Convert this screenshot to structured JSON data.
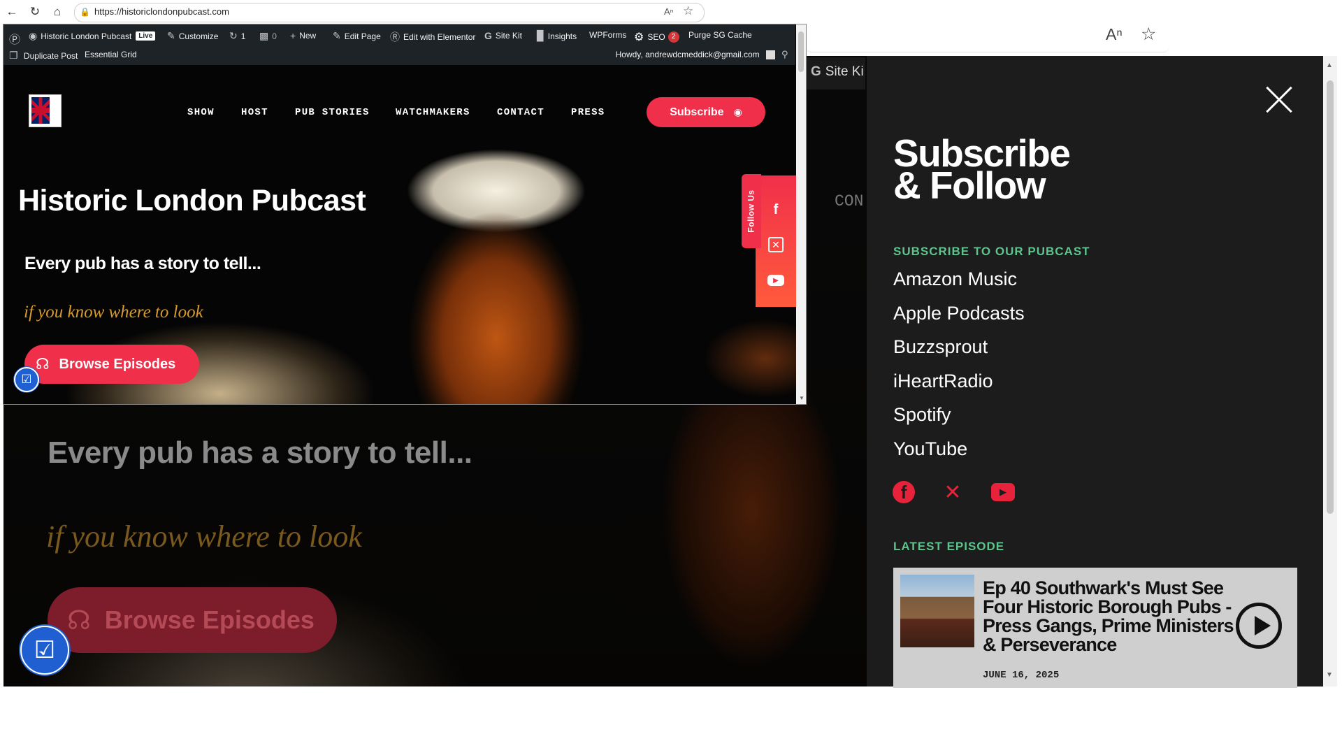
{
  "browser": {
    "url": "https://historiclondonpubcast.com",
    "read_aloud_glyph": "Aᴀ",
    "star_glyph": "☆"
  },
  "wp_admin_bar": {
    "site_name": "Historic London Pubcast",
    "live_badge": "Live",
    "customize": "Customize",
    "updates_count": "1",
    "comments_count": "0",
    "new": "New",
    "edit_page": "Edit Page",
    "edit_elementor": "Edit with Elementor",
    "site_kit": "Site Kit",
    "insights": "Insights",
    "wpforms": "WPForms",
    "seo": "SEO",
    "seo_count": "2",
    "purge_cache": "Purge SG Cache",
    "duplicate_post": "Duplicate Post",
    "essential_grid": "Essential Grid",
    "howdy": "Howdy, andrewdcmeddick@gmail.com"
  },
  "nav": {
    "items": [
      "SHOW",
      "HOST",
      "PUB STORIES",
      "WATCHMAKERS",
      "CONTACT",
      "PRESS"
    ],
    "subscribe_label": "Subscribe"
  },
  "hero": {
    "title": "Historic London Pubcast",
    "tagline": "Every pub has a story to tell...",
    "script": "if you know where to look",
    "browse_label": "Browse Episodes",
    "follow_us": "Follow Us"
  },
  "background_page": {
    "tagline": "Every pub has a story to tell...",
    "script": "if you know where to look",
    "browse_label": "Browse Episodes",
    "con_fragment": "CON",
    "site_kit_fragment": "Site Ki"
  },
  "panel": {
    "title_line1": "Subscribe",
    "title_line2": "& Follow",
    "subscribe_heading": "SUBSCRIBE TO OUR PUBCAST",
    "platforms": [
      "Amazon Music",
      "Apple Podcasts",
      "Buzzsprout",
      "iHeartRadio",
      "Spotify",
      "YouTube"
    ],
    "latest_heading": "LATEST EPISODE",
    "episode_title": "Ep 40 Southwark's Must See Four Historic Borough Pubs - Press Gangs, Prime Ministers & Perseverance",
    "episode_date": "JUNE 16, 2025"
  },
  "icons": {
    "back": "back-arrow-icon",
    "refresh": "refresh-icon",
    "home": "home-icon",
    "lock": "lock-icon",
    "facebook": "facebook-icon",
    "x": "x-icon",
    "youtube": "youtube-icon",
    "close": "close-icon",
    "play": "play-icon",
    "headphones": "headphones-icon",
    "podcast": "podcast-icon",
    "accessibility": "accessibility-icon"
  },
  "colors": {
    "accent_red": "#f0304a",
    "panel_bg": "#1c1c1c",
    "heading_green": "#5cc48c",
    "wp_bar": "#1d2327",
    "accessibility_blue": "#1f5fd1"
  }
}
